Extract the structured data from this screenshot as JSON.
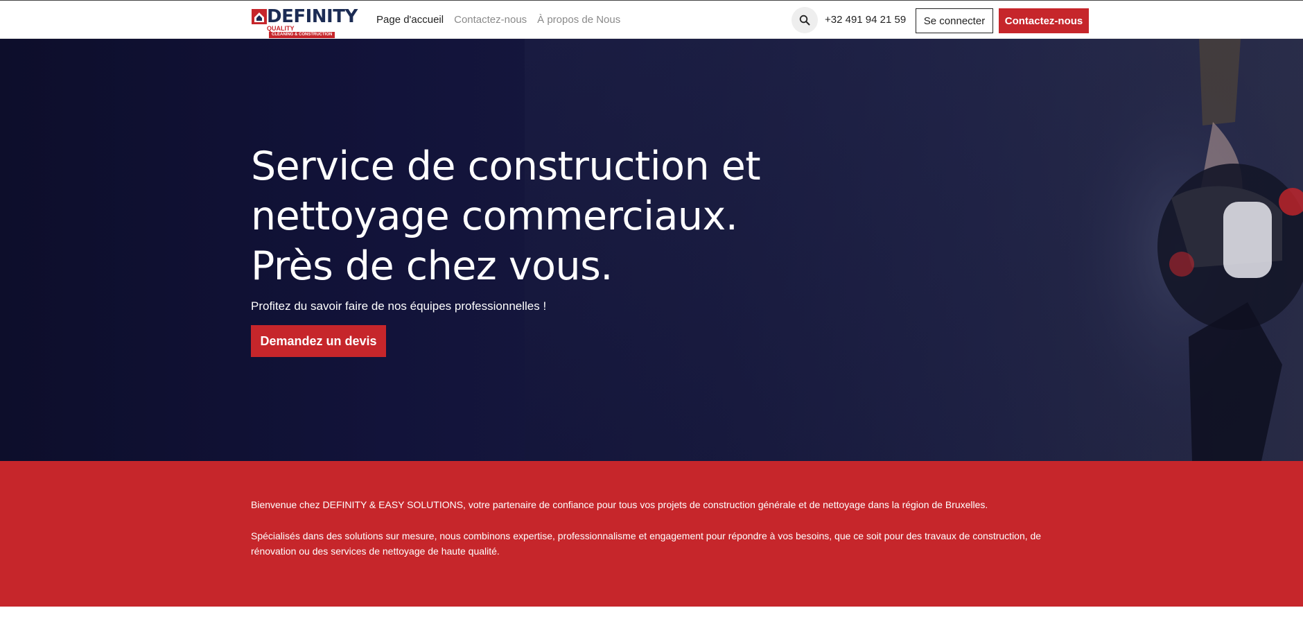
{
  "brand": {
    "name": "DEFINITY",
    "tagline_quality": "QUALITY",
    "tagline_bar": "CLEANING & CONSTRUCTION",
    "colors": {
      "primary_red": "#c6262b",
      "navy": "#1c2c54"
    }
  },
  "nav": {
    "items": [
      {
        "label": "Page d'accueil",
        "active": true
      },
      {
        "label": "Contactez-nous",
        "active": false
      },
      {
        "label": "À propos de Nous",
        "active": false
      }
    ]
  },
  "header": {
    "search_icon": "search-icon",
    "phone": "+32 491 94 21 59",
    "login_label": "Se connecter",
    "contact_label": "Contactez-nous"
  },
  "hero": {
    "title_lines": [
      "Service de construction et",
      "nettoyage commerciaux.",
      "Près de chez vous."
    ],
    "subtitle": "Profitez du savoir faire de nos équipes professionnelles !",
    "cta_label": "Demandez un devis"
  },
  "intro": {
    "paragraph1": " Bienvenue chez DEFINITY & EASY SOLUTIONS, votre partenaire de confiance pour tous vos projets de construction générale et de nettoyage dans la région de Bruxelles.",
    "paragraph2": "Spécialisés dans des solutions sur mesure, nous combinons expertise, professionnalisme et engagement pour répondre à vos besoins, que ce soit pour des travaux de construction, de rénovation ou des services de nettoyage de haute qualité."
  }
}
